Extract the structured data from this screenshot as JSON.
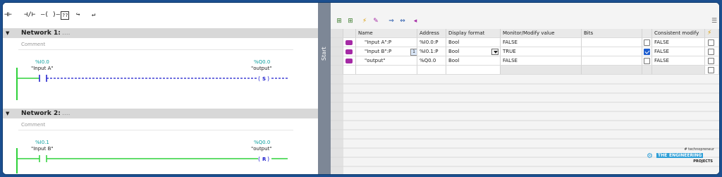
{
  "ladder_toolbar": {
    "icons": [
      "no-contact-icon",
      "nc-contact-icon",
      "coil-icon",
      "empty-box-icon",
      "open-branch-icon",
      "close-branch-icon"
    ],
    "labels": [
      "⊣⊢",
      "⊣/⊢",
      "–( )–",
      "??",
      "↪",
      "↵"
    ]
  },
  "networks": [
    {
      "label": "Network 1:",
      "title_placeholder": "....",
      "comment": "Comment",
      "contact_address": "%I0.0",
      "contact_symbol": "\"Input A\"",
      "coil_address": "%Q0.0",
      "coil_symbol": "\"output\"",
      "coil_type": "S"
    },
    {
      "label": "Network 2:",
      "title_placeholder": "....",
      "comment": "Comment",
      "contact_address": "%I0.1",
      "contact_symbol": "\"Input B\"",
      "coil_address": "%Q0.0",
      "coil_symbol": "\"output\"",
      "coil_type": "R"
    }
  ],
  "splitter": {
    "label": "Start"
  },
  "watch_table": {
    "columns": [
      "",
      "i",
      "Name",
      "Address",
      "Display format",
      "Monitor/Modify value",
      "Bits",
      "",
      "Consistent modify",
      ""
    ],
    "rows": [
      {
        "name": "\"Input A\":P",
        "address": "%I0.0:P",
        "format": "Bool",
        "value": "FALSE",
        "checked": false,
        "consistent": "FALSE"
      },
      {
        "name": "\"Input B\":P",
        "address": "%I0.1:P",
        "format": "Bool",
        "value": "TRUE",
        "checked": true,
        "consistent": "FALSE"
      },
      {
        "name": "\"output\"",
        "address": "%Q0.0",
        "format": "Bool",
        "value": "FALSE",
        "checked": false,
        "consistent": "FALSE"
      }
    ]
  },
  "colors": {
    "rail": "#2ed23a",
    "dashed_wire": "#1a1acc",
    "address": "#0b9e9e",
    "tag_icon": "#a52aa5",
    "frame": "#1c4f8f"
  },
  "logo": {
    "small_text": "# technopreneur",
    "the": "THE",
    "engineering": "ENGINEERING",
    "projects": "PROJECTS"
  }
}
